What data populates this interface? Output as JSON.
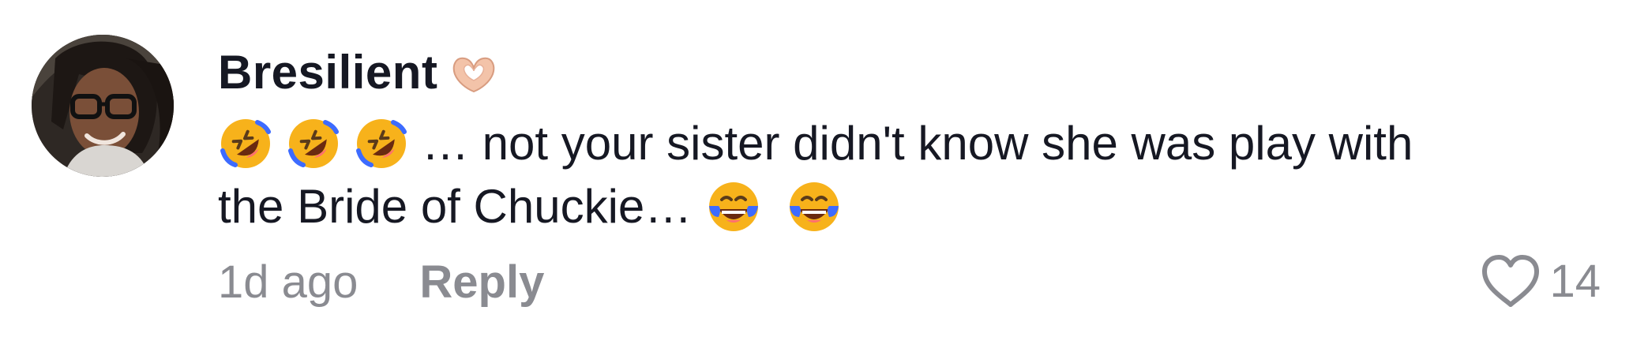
{
  "comment": {
    "username": "Bresilient",
    "username_badge_icon": "heart-hands-icon",
    "text_line1": "… not your sister didn't know she was play with",
    "text_line2": "the Bride of Chuckie…",
    "line1_emojis": [
      "rolling-on-floor-laughing-emoji",
      "rolling-on-floor-laughing-emoji",
      "rolling-on-floor-laughing-emoji"
    ],
    "line2_emojis": [
      "face-with-tears-of-joy-emoji",
      "face-with-tears-of-joy-emoji"
    ],
    "time": "1d ago",
    "reply_label": "Reply",
    "like_icon": "heart-outline-icon",
    "like_count": "14"
  },
  "colors": {
    "primary_text": "#161823",
    "secondary_text": "#8a8b91",
    "emoji_yellow": "#f7b21b",
    "emoji_tears": "#3d6bff",
    "badge_skin": "#f3c3a9"
  }
}
